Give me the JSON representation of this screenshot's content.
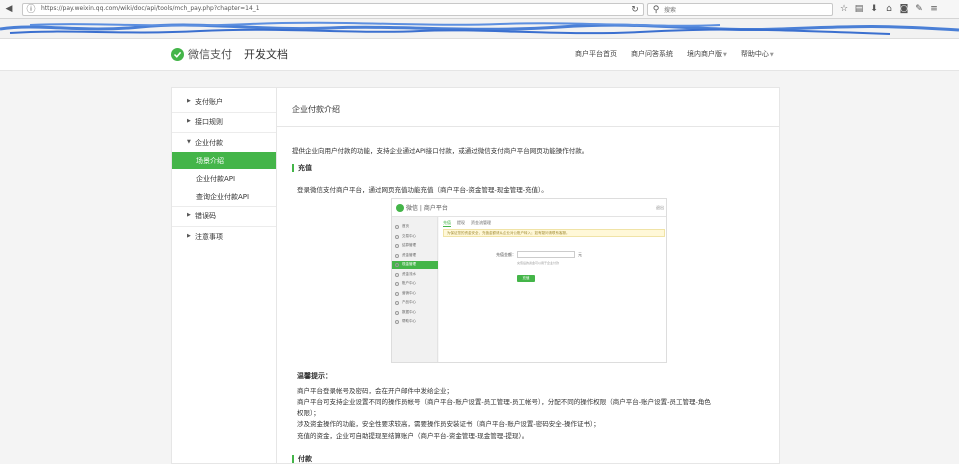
{
  "browser": {
    "url": "https://pay.weixin.qq.com/wiki/doc/api/tools/mch_pay.php?chapter=14_1",
    "search_placeholder": "搜索",
    "toolbar_icons": [
      "star-icon",
      "bookmark-list-icon",
      "download-icon",
      "home-icon",
      "pocket-icon",
      "extension-icon",
      "menu-icon"
    ]
  },
  "header": {
    "logo_text": "微信支付",
    "doc_text": "开发文档",
    "nav": [
      {
        "label": "商户平台首页",
        "caret": false
      },
      {
        "label": "商户问答系统",
        "caret": false
      },
      {
        "label": "境内商户版",
        "caret": true
      },
      {
        "label": "帮助中心",
        "caret": true
      }
    ]
  },
  "sidebar": {
    "items": [
      {
        "label": "支付账户",
        "expanded": false
      },
      {
        "label": "接口规则",
        "expanded": false
      },
      {
        "label": "企业付款",
        "expanded": true
      },
      {
        "label": "错误码",
        "expanded": false
      },
      {
        "label": "注意事项",
        "expanded": false
      }
    ],
    "subitems": [
      {
        "label": "场景介绍",
        "active": true
      },
      {
        "label": "企业付款API",
        "active": false
      },
      {
        "label": "查询企业付款API",
        "active": false
      }
    ]
  },
  "main": {
    "title": "企业付款介绍",
    "intro": "提供企业向用户付款的功能，支持企业通过API接口付款，或通过微信支付商户平台网页功能操作付款。",
    "section1": "充值",
    "section1_text": "登录微信支付商户平台，通过网页充值功能充值（商户平台-资金管理-现金管理-充值）。",
    "notes_title": "温馨提示：",
    "notes": [
      "商户平台登录帐号及密码，会在开户邮件中发给企业；",
      "商户平台可支持企业设置不同的操作员帐号（商户平台-账户设置-员工管理-员工帐号），分配不同的操作权限（商户平台-账户设置-员工管理-角色",
      "权限）；",
      "涉及资金操作的功能，安全性要求较高，需要操作员安装证书（商户平台-账户设置-密码安全-操作证书）；",
      "充值的资金，企业可自助提现至结算账户（商户平台-资金管理-现金管理-提现）。"
    ],
    "section2": "付款"
  },
  "screenshot": {
    "logo": "微信 | 商户平台",
    "header_right": "退出",
    "tabs": [
      "充值",
      "提现",
      "资金流管理"
    ],
    "warning": "为保证您的资金安全，充值金额请从企业对公账户转入；如有疑问请联系客服。",
    "side_items": [
      "首页",
      "交易中心",
      "结算管理",
      "资金管理",
      "现金管理",
      "资金流水",
      "账户中心",
      "营销中心",
      "产品中心",
      "数据中心",
      "帮助中心"
    ],
    "active_side_index": 4,
    "form_label": "充值金额：",
    "unit": "元",
    "hint": "充值后的资金可以用于企业付款",
    "button": "充值"
  }
}
